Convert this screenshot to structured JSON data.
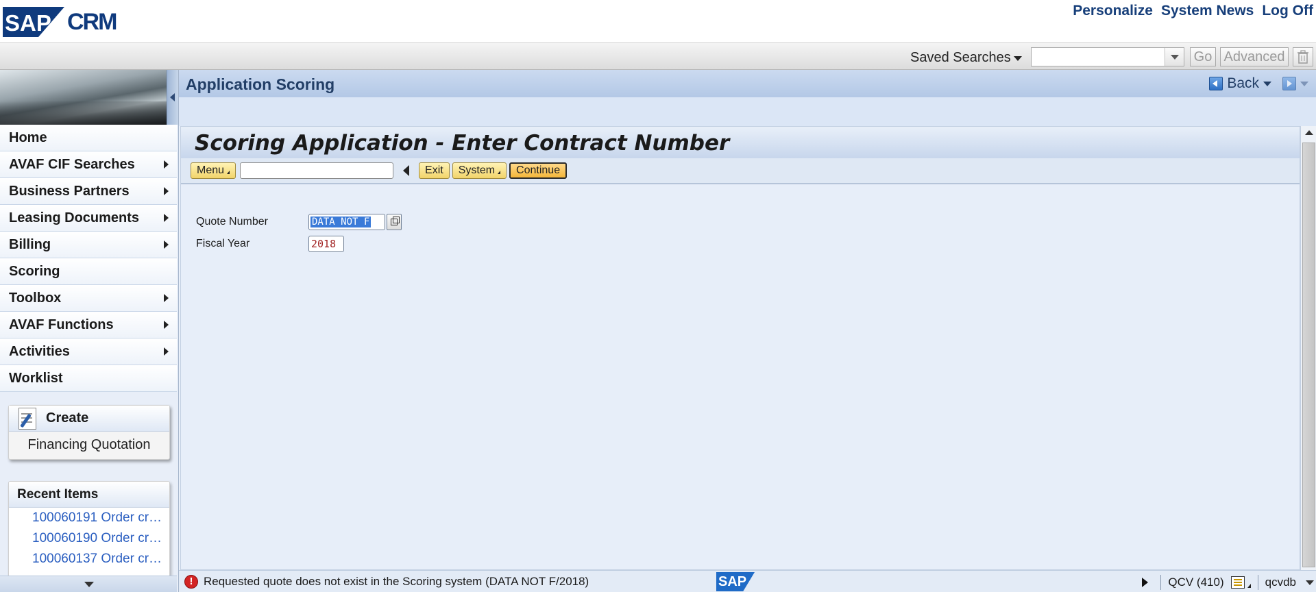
{
  "header": {
    "logo_sap": "SAP",
    "logo_product": "CRM",
    "links": [
      "Personalize",
      "System News",
      "Log Off"
    ]
  },
  "search": {
    "saved_searches_label": "Saved Searches",
    "select_value": "",
    "go_label": "Go",
    "advanced_label": "Advanced"
  },
  "nav": {
    "items": [
      {
        "label": "Home",
        "has_submenu": false
      },
      {
        "label": "AVAF CIF Searches",
        "has_submenu": true
      },
      {
        "label": "Business Partners",
        "has_submenu": true
      },
      {
        "label": "Leasing Documents",
        "has_submenu": true
      },
      {
        "label": "Billing",
        "has_submenu": true
      },
      {
        "label": "Scoring",
        "has_submenu": false
      },
      {
        "label": "Toolbox",
        "has_submenu": true
      },
      {
        "label": "AVAF Functions",
        "has_submenu": true
      },
      {
        "label": "Activities",
        "has_submenu": true
      },
      {
        "label": "Worklist",
        "has_submenu": false
      }
    ],
    "create": {
      "label": "Create",
      "link": "Financing Quotation"
    },
    "recent": {
      "title": "Recent Items",
      "items": [
        "100060191 Order cr…",
        "100060190 Order cr…",
        "100060137 Order cr…"
      ]
    }
  },
  "page": {
    "title": "Application Scoring",
    "back_label": "Back"
  },
  "gui": {
    "title": "Scoring Application - Enter Contract Number",
    "toolbar": {
      "menu_label": "Menu",
      "command_value": "",
      "exit_label": "Exit",
      "system_label": "System",
      "continue_label": "Continue"
    },
    "form": {
      "quote_number_label": "Quote Number",
      "quote_number_value": "DATA NOT F",
      "fiscal_year_label": "Fiscal Year",
      "fiscal_year_value": "2018"
    }
  },
  "status": {
    "message": "Requested quote does not exist in the Scoring system (DATA NOT F/2018)",
    "sap_logo": "SAP",
    "system": "QCV (410)",
    "server": "qcvdb"
  },
  "colors": {
    "brand_blue": "#0f3a7d",
    "title_blue": "#223e66",
    "link_blue": "#2a5ec0",
    "button_yellow": "#f2d46a",
    "error_red": "#d32424"
  },
  "icons": {
    "status": "error-icon",
    "f4": "value-help-icon",
    "create": "create-document-icon"
  }
}
